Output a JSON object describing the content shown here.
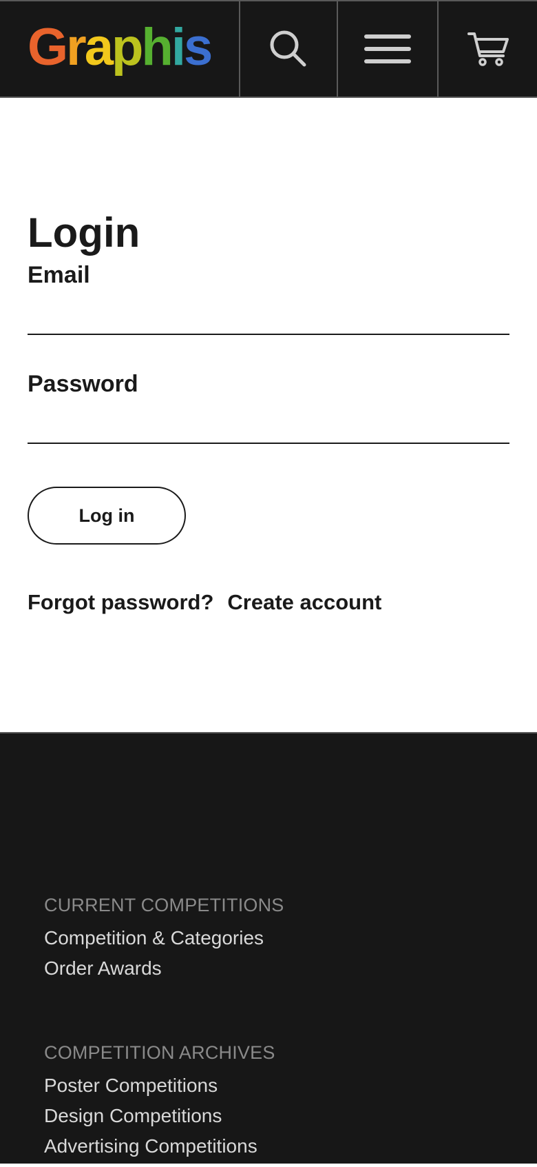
{
  "header": {
    "logo_letters": [
      {
        "ch": "G",
        "color": "#e8632c"
      },
      {
        "ch": "r",
        "color": "#f0a021"
      },
      {
        "ch": "a",
        "color": "#f2c81c"
      },
      {
        "ch": "p",
        "color": "#bcc21e"
      },
      {
        "ch": "h",
        "color": "#56b030"
      },
      {
        "ch": "i",
        "color": "#32a8a0"
      },
      {
        "ch": "s",
        "color": "#3b6fd0"
      }
    ],
    "icons": [
      "search-icon",
      "menu-icon",
      "cart-icon"
    ],
    "icon_color": "#cfcfcf"
  },
  "login": {
    "title": "Login",
    "email_label": "Email",
    "email_value": "",
    "password_label": "Password",
    "password_value": "",
    "button_label": "Log in",
    "forgot_link": "Forgot password?",
    "create_link": "Create account"
  },
  "footer": {
    "sections": [
      {
        "heading": "CURRENT COMPETITIONS",
        "links": [
          "Competition & Categories",
          "Order Awards"
        ]
      },
      {
        "heading": "COMPETITION ARCHIVES",
        "links": [
          "Poster Competitions",
          "Design Competitions",
          "Advertising Competitions"
        ]
      }
    ]
  }
}
